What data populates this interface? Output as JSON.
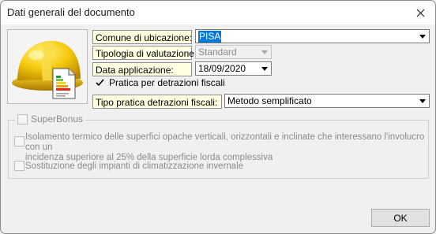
{
  "window": {
    "title": "Dati generali del documento"
  },
  "fields": {
    "comune_label": "Comune di ubicazione:",
    "comune_value": "PISA",
    "tipologia_label": "Tipologia di valutazione:",
    "tipologia_value": "Standard",
    "data_label": "Data applicazione:",
    "data_value": "18/09/2020",
    "pratica_checkbox_label": "Pratica per detrazioni fiscali",
    "pratica_checked": true,
    "tipo_pratica_label": "Tipo pratica detrazioni fiscali:",
    "tipo_pratica_value": "Metodo semplificato"
  },
  "superbonus": {
    "title": "SuperBonus",
    "isolamento_line1": "Isolamento termico delle superfici opache verticali, orizzontali e inclinate che interessano l'involucro con un",
    "isolamento_line2": "incidenza superiore al 25% della superficie lorda complessiva",
    "sostituzione": "Sostituzione degli impianti di climatizzazione invernale"
  },
  "buttons": {
    "ok": "OK"
  },
  "icons": {
    "close": "close-icon",
    "helmet": "hard-hat-icon",
    "document": "energy-certificate-icon",
    "dropdown": "chevron-down-icon",
    "check": "check-icon"
  },
  "colors": {
    "label_bg": "#ffffe1",
    "selection": "#0078d7",
    "helmet": "#f2c200"
  }
}
